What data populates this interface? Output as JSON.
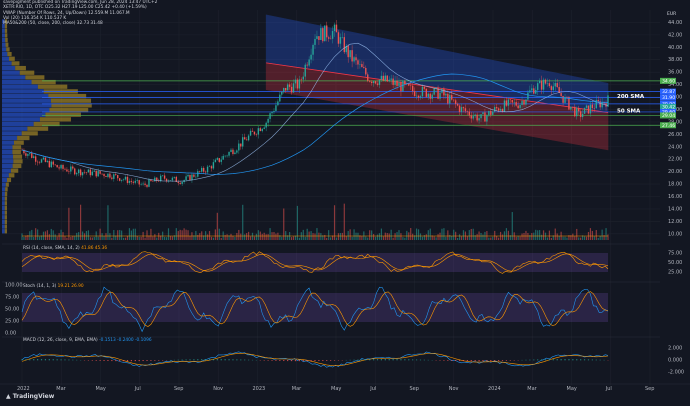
{
  "header": {
    "publisher": "savepigment published on TradingView.com, Jun 28, 2024 13:47 UTC+2",
    "ticker_line": "XETR:RIO, 1D, OTC  O25.32  H27.19  L25.00  C25.42  +0.40 (+1.59%)",
    "vwap_line": "VWAP (Number Of Rows, 24, Up/Down)  12.559.M  11.067.M",
    "vol_line": "Vol (20)  116.354 K  110.537 K",
    "ma_line": "MA50&200 (50, close, 200, close)  32.73  31.48",
    "currency": "EUR"
  },
  "colors": {
    "background": "#131722",
    "up": "#26a69a",
    "down": "#ef5350",
    "channel_upper": "#2962ff",
    "channel_lower": "#f23645",
    "level_green": "#4caf50",
    "ma200": "#2196f3",
    "ma50": "#2196f3",
    "rsi_band": "#7e57c2",
    "volume_profile_up": "#2962ff",
    "volume_profile_down": "#c9a227"
  },
  "chart_data": [
    {
      "type": "candlestick",
      "panel": "price",
      "y_ticks": [
        44.0,
        42.0,
        40.0,
        38.0,
        36.0,
        34.0,
        32.0,
        30.0,
        28.0,
        26.0,
        24.0,
        22.0,
        20.0,
        18.0,
        16.0,
        14.0,
        12.0,
        10.0
      ],
      "x_ticks": [
        "2022",
        "Mar",
        "May",
        "Jul",
        "Sep",
        "Nov",
        "2023",
        "Mar",
        "May",
        "Jul",
        "Sep",
        "Nov",
        "2024",
        "Mar",
        "May",
        "Jul",
        "Sep"
      ],
      "ylim": [
        9.0,
        46.0
      ],
      "level_labels": [
        {
          "text": "200 SMA",
          "price": 32.2
        },
        {
          "text": "50 SMA",
          "price": 29.8
        }
      ],
      "price_tags": [
        {
          "value": 34.6,
          "color": "#4caf50"
        },
        {
          "value": 32.87,
          "color": "#2962ff"
        },
        {
          "value": 31.9,
          "color": "#2962ff"
        },
        {
          "value": 30.9,
          "color": "#2962ff"
        },
        {
          "value": 30.42,
          "color": "#26a69a"
        },
        {
          "value": 29.6,
          "color": "#2962ff"
        },
        {
          "value": 29.04,
          "color": "#4caf50"
        },
        {
          "value": 27.46,
          "color": "#4caf50"
        }
      ],
      "horizontal_levels": [
        34.6,
        32.87,
        31.9,
        30.9,
        29.6,
        29.04,
        27.46
      ],
      "close_path": [
        [
          0,
          23.5
        ],
        [
          8,
          22.0
        ],
        [
          20,
          20.5
        ],
        [
          30,
          20.0
        ],
        [
          45,
          19.5
        ],
        [
          55,
          18.5
        ],
        [
          62,
          17.8
        ],
        [
          72,
          19.0
        ],
        [
          82,
          18.5
        ],
        [
          95,
          20.5
        ],
        [
          110,
          24.0
        ],
        [
          125,
          28.0
        ],
        [
          135,
          33.5
        ],
        [
          142,
          34.0
        ],
        [
          150,
          42.0
        ],
        [
          160,
          42.5
        ],
        [
          168,
          38.5
        ],
        [
          178,
          35.0
        ],
        [
          188,
          34.5
        ],
        [
          200,
          33.0
        ],
        [
          215,
          32.5
        ],
        [
          225,
          30.0
        ],
        [
          235,
          28.5
        ],
        [
          245,
          30.5
        ],
        [
          255,
          31.0
        ],
        [
          262,
          33.5
        ],
        [
          270,
          34.5
        ],
        [
          278,
          31.5
        ],
        [
          285,
          29.0
        ],
        [
          292,
          30.5
        ],
        [
          300,
          31.5
        ]
      ]
    },
    {
      "type": "line",
      "panel": "rsi",
      "name": "RSI (14, close, SMA, 14, 2)",
      "values_text": "41.86  45.36",
      "y_ticks": [
        75.0,
        50.0,
        25.0
      ],
      "ylim": [
        20,
        80
      ]
    },
    {
      "type": "line",
      "panel": "stoch",
      "name": "Stoch (14, 1, 3)",
      "values_text": "19.21  26.90",
      "y_ticks": [
        100.0,
        75.0,
        50.0,
        25.0,
        0.0
      ],
      "ylim": [
        0,
        100
      ]
    },
    {
      "type": "bar",
      "panel": "macd",
      "name": "MACD (12, 26, close, 9, EMA, EMA)",
      "values_text": "-0.1513  -0.2400  -0.1096",
      "y_ticks": [
        2.0,
        0.0,
        -2.0
      ],
      "ylim": [
        -2.5,
        2.5
      ]
    }
  ]
}
